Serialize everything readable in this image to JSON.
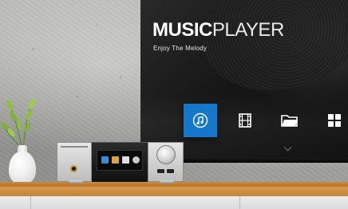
{
  "screen": {
    "title_bold": "MUSIC",
    "title_light": "PLAYER",
    "subtitle": "Enjoy The Melody",
    "menu": [
      {
        "icon": "music-note-icon",
        "active": true
      },
      {
        "icon": "film-icon",
        "active": false
      },
      {
        "icon": "folder-icon",
        "active": false
      },
      {
        "icon": "grid-apps-icon",
        "active": false
      }
    ],
    "accent_color": "#1577c9"
  },
  "scene": {
    "objects": [
      "concrete-wall",
      "wall-mounted-tv",
      "wooden-shelf",
      "white-vase-with-plant",
      "audio-player-device"
    ]
  }
}
